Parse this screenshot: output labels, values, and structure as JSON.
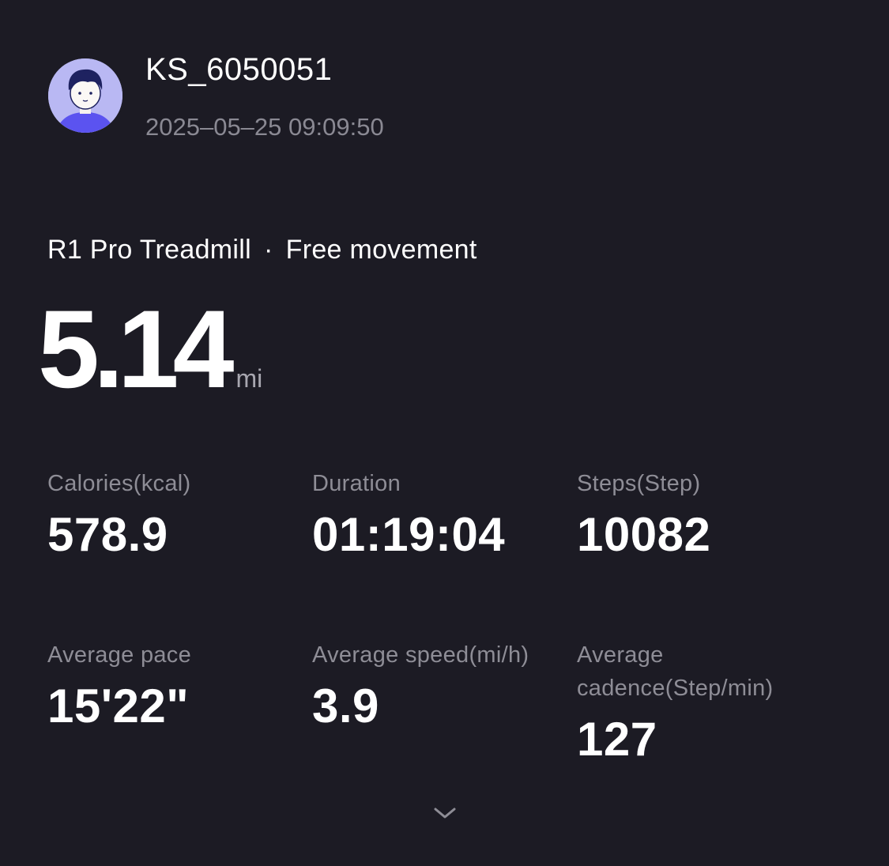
{
  "user": {
    "name": "KS_6050051",
    "timestamp": "2025–05–25 09:09:50"
  },
  "activity": {
    "device": "R1 Pro Treadmill",
    "separator": "·",
    "mode": "Free movement"
  },
  "distance": {
    "value": "5.14",
    "unit": "mi"
  },
  "metrics": [
    {
      "label": "Calories(kcal)",
      "value": "578.9"
    },
    {
      "label": "Duration",
      "value": "01:19:04"
    },
    {
      "label": "Steps(Step)",
      "value": "10082"
    },
    {
      "label": "Average pace",
      "value": "15'22\""
    },
    {
      "label": "Average speed(mi/h)",
      "value": "3.9"
    },
    {
      "label": "Average cadence(Step/min)",
      "value": "127"
    }
  ],
  "icons": {
    "avatar": "avatar-icon",
    "expand": "chevron-down-icon"
  },
  "colors": {
    "background": "#1c1b24",
    "text_primary": "#ffffff",
    "text_secondary": "#8e8d96",
    "avatar_bg": "#b9b8f3",
    "avatar_shirt": "#5b53f0"
  }
}
